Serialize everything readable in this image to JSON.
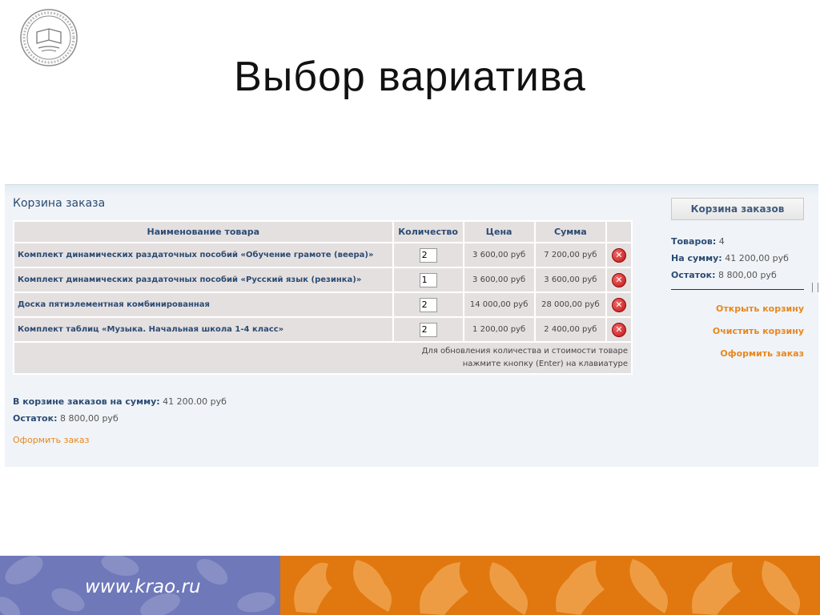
{
  "slide": {
    "title": "Выбор вариатива"
  },
  "cart": {
    "heading": "Корзина заказа",
    "columns": [
      "Наименование товара",
      "Количество",
      "Цена",
      "Сумма"
    ],
    "rows": [
      {
        "name": "Комплект динамических раздаточных пособий «Обучение грамоте (веера)»",
        "qty": "2",
        "price": "3 600,00 руб",
        "sum": "7 200,00 руб"
      },
      {
        "name": "Комплект динамических раздаточных пособий «Русский язык (резинка)»",
        "qty": "1",
        "price": "3 600,00 руб",
        "sum": "3 600,00 руб"
      },
      {
        "name": "Доска пятиэлементная комбинированная",
        "qty": "2",
        "price": "14 000,00 руб",
        "sum": "28 000,00 руб"
      },
      {
        "name": "Комплект таблиц «Музыка. Начальная школа 1-4 класс»",
        "qty": "2",
        "price": "1 200,00 руб",
        "sum": "2 400,00 руб"
      }
    ],
    "note_line1": "Для обновления количества и стоимости товаре",
    "note_line2": "нажмите кнопку (Enter) на клавиатуре",
    "total_label": "В корзине заказов на сумму:",
    "total_value": "41 200.00 руб",
    "remainder_label": "Остаток:",
    "remainder_value": "8 800,00 руб",
    "order_link": "Оформить заказ"
  },
  "sidebar": {
    "button": "Корзина заказов",
    "items_label": "Товаров:",
    "items_value": "4",
    "sum_label": "На сумму:",
    "sum_value": "41 200,00 руб",
    "remainder_label": "Остаток:",
    "remainder_value": "8 800,00 руб",
    "open_link": "Открыть корзину",
    "clear_link": "Очистить корзину",
    "order_link": "Оформить заказ"
  },
  "footer": {
    "url": "www.krao.ru"
  },
  "colors": {
    "link": "#e8871e",
    "heading": "#2b4b73",
    "footer_blue": "#6f78b9",
    "footer_orange": "#e0780f",
    "delete": "#c21212"
  },
  "icons": {
    "delete": "delete-icon",
    "logo": "seal-logo"
  }
}
